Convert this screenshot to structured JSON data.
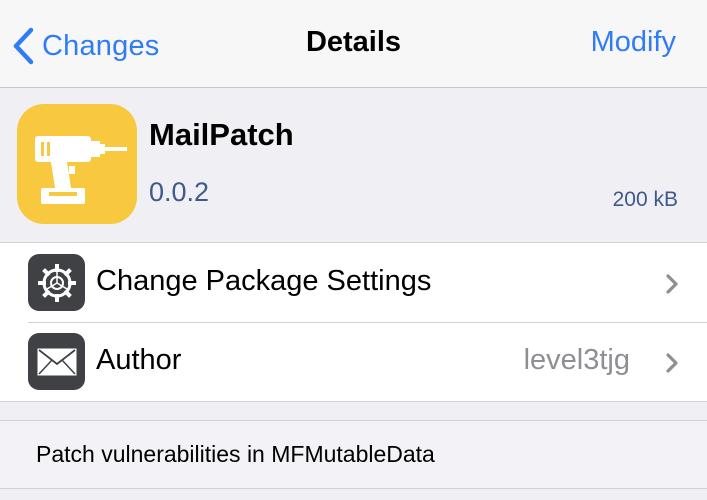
{
  "navbar": {
    "back_label": "Changes",
    "title": "Details",
    "right_label": "Modify"
  },
  "package": {
    "name": "MailPatch",
    "version": "0.0.2",
    "size": "200 kB",
    "icon": "drill-icon"
  },
  "cells": [
    {
      "label": "Change Package Settings",
      "detail": "",
      "icon": "gear-icon"
    },
    {
      "label": "Author",
      "detail": "level3tjg",
      "icon": "mail-icon"
    }
  ],
  "description": "Patch vulnerabilities in MFMutableData",
  "colors": {
    "accent": "#2f7cf6",
    "icon_bg": "#f8c93e",
    "cell_icon_bg": "#3f4145",
    "version_text": "#3d5a8a",
    "background": "#efeff4"
  }
}
